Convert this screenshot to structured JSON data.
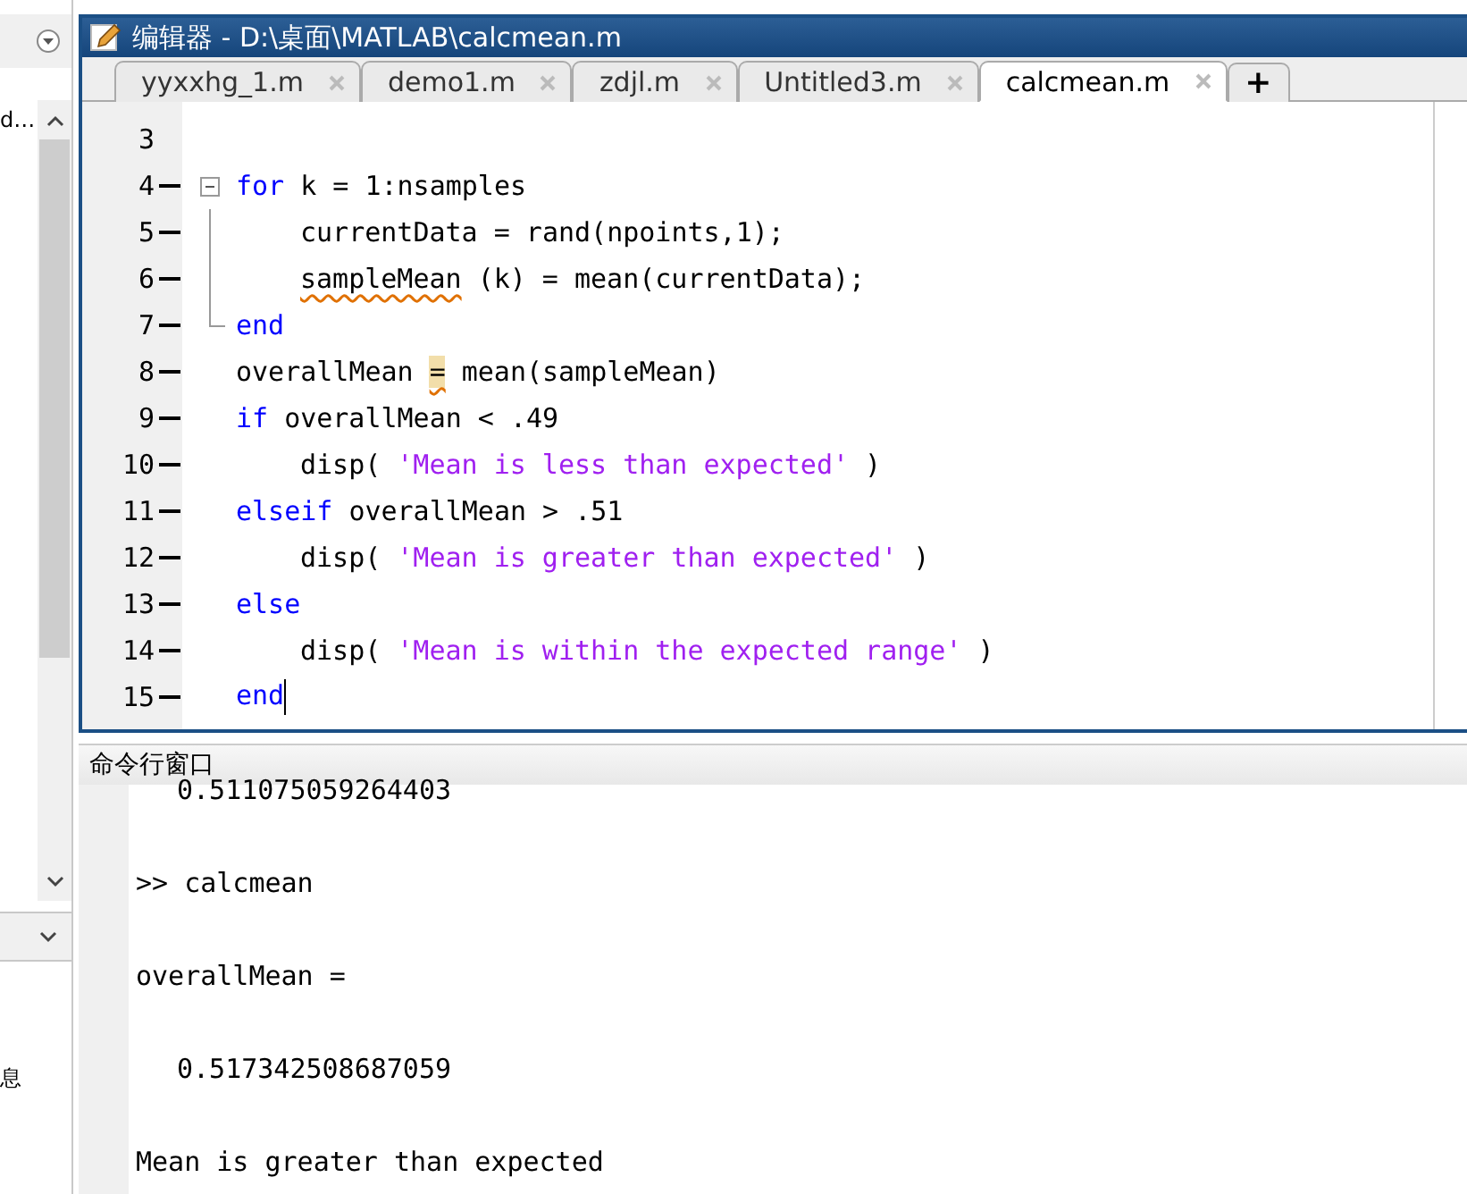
{
  "sidebar": {
    "item": "d…",
    "lower_item": "息"
  },
  "editor": {
    "title": "编辑器 - D:\\桌面\\MATLAB\\calcmean.m",
    "tabs": [
      {
        "label": "yyxxhg_1.m",
        "selected": false
      },
      {
        "label": "demo1.m",
        "selected": false
      },
      {
        "label": "zdjl.m",
        "selected": false
      },
      {
        "label": "Untitled3.m",
        "selected": false
      },
      {
        "label": "calcmean.m",
        "selected": true
      }
    ],
    "new_tab": "+",
    "lines": [
      {
        "number": "3",
        "executable": false,
        "kind": "code"
      },
      {
        "number": "4",
        "executable": true,
        "indented": false,
        "kind": "open",
        "segments": [
          {
            "kind": "keyword",
            "text": "for"
          },
          {
            "kind": "plain",
            "text": "k = 1:nsamples"
          }
        ]
      },
      {
        "number": "5",
        "executable": true,
        "indented": true,
        "kind": "inner",
        "segments": [
          {
            "kind": "plain",
            "text": "currentData = rand(npoints,1);"
          }
        ]
      },
      {
        "number": "6",
        "executable": true,
        "indented": true,
        "kind": "inner",
        "segments": [
          {
            "kind": "warning",
            "text": "sampleMean"
          },
          {
            "kind": "plain",
            "text": "(k) = mean(currentData);"
          }
        ]
      },
      {
        "number": "7",
        "executable": true,
        "indented": false,
        "kind": "close",
        "segments": [
          {
            "kind": "keyword",
            "text": "end"
          }
        ]
      },
      {
        "number": "8",
        "executable": true,
        "indented": false,
        "kind": "code",
        "segments": [
          {
            "kind": "plain",
            "text": "overallMean"
          },
          {
            "kind": "warning",
            "text": "="
          },
          {
            "kind": "plain",
            "text": "mean(sampleMean)"
          }
        ]
      },
      {
        "number": "9",
        "executable": true,
        "indented": false,
        "kind": "code",
        "segments": [
          {
            "kind": "keyword",
            "text": "if"
          },
          {
            "kind": "plain",
            "text": "overallMean < .49"
          }
        ]
      },
      {
        "number": "10",
        "executable": true,
        "indented": true,
        "kind": "code",
        "segments": [
          {
            "kind": "plain",
            "text": "disp("
          },
          {
            "kind": "string",
            "text": "'Mean is less than expected'"
          },
          {
            "kind": "plain",
            "text": ")"
          }
        ]
      },
      {
        "number": "11",
        "executable": true,
        "indented": false,
        "kind": "code",
        "segments": [
          {
            "kind": "keyword",
            "text": "elseif"
          },
          {
            "kind": "plain",
            "text": "overallMean > .51"
          }
        ]
      },
      {
        "number": "12",
        "executable": true,
        "indented": true,
        "kind": "code",
        "segments": [
          {
            "kind": "plain",
            "text": "disp("
          },
          {
            "kind": "string",
            "text": "'Mean is greater than expected'"
          },
          {
            "kind": "plain",
            "text": ")"
          }
        ]
      },
      {
        "number": "13",
        "executable": true,
        "indented": false,
        "kind": "code",
        "segments": [
          {
            "kind": "keyword",
            "text": "else"
          }
        ]
      },
      {
        "number": "14",
        "executable": true,
        "indented": true,
        "kind": "code",
        "segments": [
          {
            "kind": "plain",
            "text": "disp("
          },
          {
            "kind": "string",
            "text": "'Mean is within the expected range'"
          },
          {
            "kind": "plain",
            "text": ")"
          }
        ]
      },
      {
        "number": "15",
        "executable": true,
        "indented": false,
        "kind": "code",
        "cursor": true,
        "segments": [
          {
            "kind": "keyword",
            "text": "end"
          }
        ]
      }
    ]
  },
  "command_window": {
    "title": "命令行窗口",
    "lines": [
      {
        "text": "0.511075059264403",
        "indented": true
      },
      {
        "text": ">> calcmean",
        "indented": false
      },
      {
        "text": "overallMean =",
        "indented": false
      },
      {
        "text": "0.517342508687059",
        "indented": true
      },
      {
        "text": "Mean is greater than expected",
        "indented": false
      }
    ]
  }
}
